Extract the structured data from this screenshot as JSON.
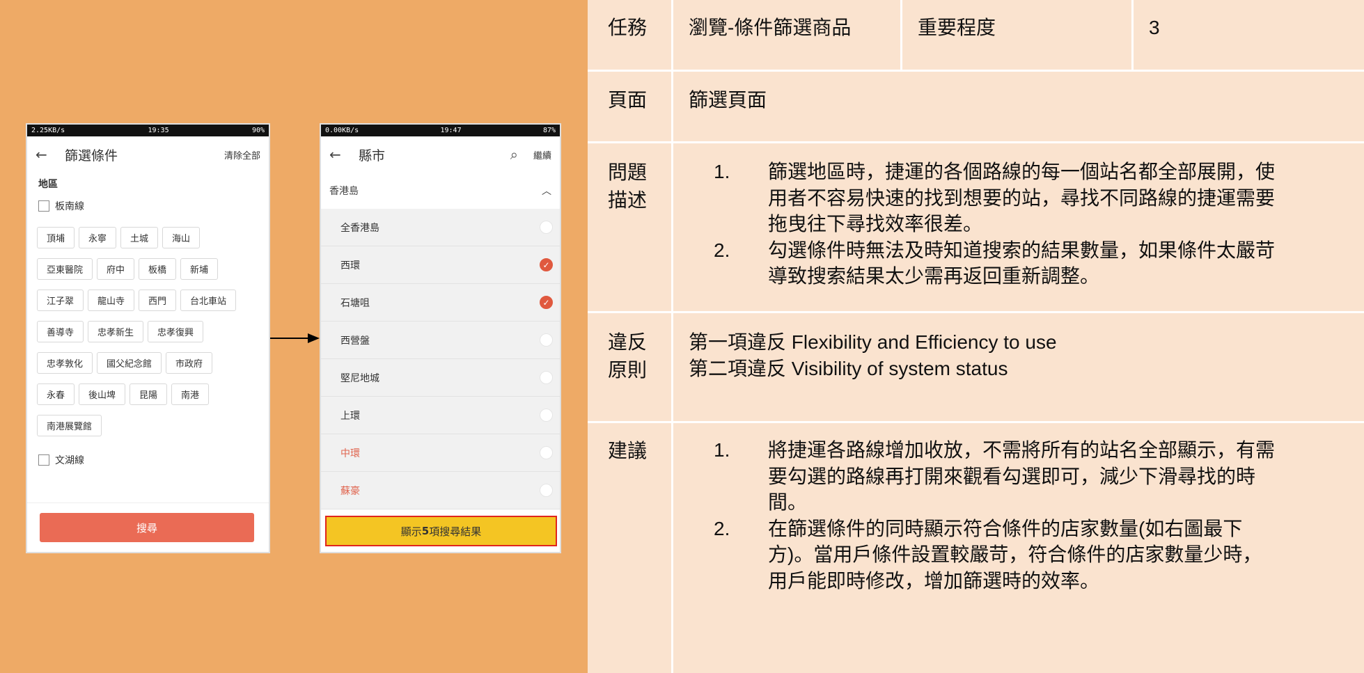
{
  "phone_filter": {
    "status_left": "2.25KB/s",
    "status_time": "19:35",
    "status_battery": "90%",
    "title": "篩選條件",
    "clear_all": "清除全部",
    "section_region": "地區",
    "line_1": "板南線",
    "chip_rows": [
      [
        "頂埔",
        "永寧",
        "土城",
        "海山"
      ],
      [
        "亞東醫院",
        "府中",
        "板橋",
        "新埔"
      ],
      [
        "江子翠",
        "龍山寺",
        "西門",
        "台北車站"
      ],
      [
        "善導寺",
        "忠孝新生",
        "忠孝復興"
      ],
      [
        "忠孝敦化",
        "國父紀念館",
        "市政府"
      ],
      [
        "永春",
        "後山埤",
        "昆陽",
        "南港"
      ],
      [
        "南港展覽館"
      ]
    ],
    "line_2": "文湖線",
    "search_button": "搜尋"
  },
  "phone_region": {
    "status_left": "0.00KB/s",
    "status_time": "19:47",
    "status_battery": "87%",
    "title": "縣市",
    "continue": "繼續",
    "region": "香港島",
    "items": [
      {
        "label": "全香港島",
        "checked": false,
        "highlight": false
      },
      {
        "label": "西環",
        "checked": true,
        "highlight": false
      },
      {
        "label": "石塘咀",
        "checked": true,
        "highlight": false
      },
      {
        "label": "西營盤",
        "checked": false,
        "highlight": false
      },
      {
        "label": "堅尼地城",
        "checked": false,
        "highlight": false
      },
      {
        "label": "上環",
        "checked": false,
        "highlight": false
      },
      {
        "label": "中環",
        "checked": false,
        "highlight": true
      },
      {
        "label": "蘇豪",
        "checked": false,
        "highlight": true
      }
    ],
    "results_button_pre": "顯示 ",
    "results_count": "5",
    "results_button_post": " 項搜尋結果"
  },
  "table": {
    "task_label": "任務",
    "task_value": "瀏覽-條件篩選商品",
    "importance_label": "重要程度",
    "importance_value": "3",
    "page_label": "頁面",
    "page_value": "篩選頁面",
    "problem_label_1": "問題",
    "problem_label_2": "描述",
    "problems": [
      {
        "num": "1.",
        "lines": [
          "篩選地區時，捷運的各個路線的每一個站名都全部展開，使",
          "用者不容易快速的找到想要的站，尋找不同路線的捷運需要",
          "拖曳往下尋找效率很差。"
        ]
      },
      {
        "num": "2.",
        "lines": [
          "勾選條件時無法及時知道搜索的結果數量，如果條件太嚴苛",
          "導致搜索結果太少需再返回重新調整。"
        ]
      }
    ],
    "violation_label_1": "違反",
    "violation_label_2": "原則",
    "violation_1": "第一項違反 Flexibility and Efficiency to use",
    "violation_2": "第二項違反 Visibility of system status",
    "suggestion_label": "建議",
    "suggestions": [
      {
        "num": "1.",
        "lines": [
          "將捷運各路線增加收放，不需將所有的站名全部顯示，有需",
          "要勾選的路線再打開來觀看勾選即可，減少下滑尋找的時",
          "間。"
        ]
      },
      {
        "num": "2.",
        "lines": [
          "在篩選條件的同時顯示符合條件的店家數量(如右圖最下",
          "方)。當用戶條件設置較嚴苛，符合條件的店家數量少時，",
          "用戶能即時修改，增加篩選時的效率。"
        ]
      }
    ]
  },
  "colors": {
    "slide_bg": "#eeaa66",
    "table_bg": "#fae3cf",
    "accent_red": "#ea6b55",
    "highlight_yellow": "#f4c523"
  }
}
